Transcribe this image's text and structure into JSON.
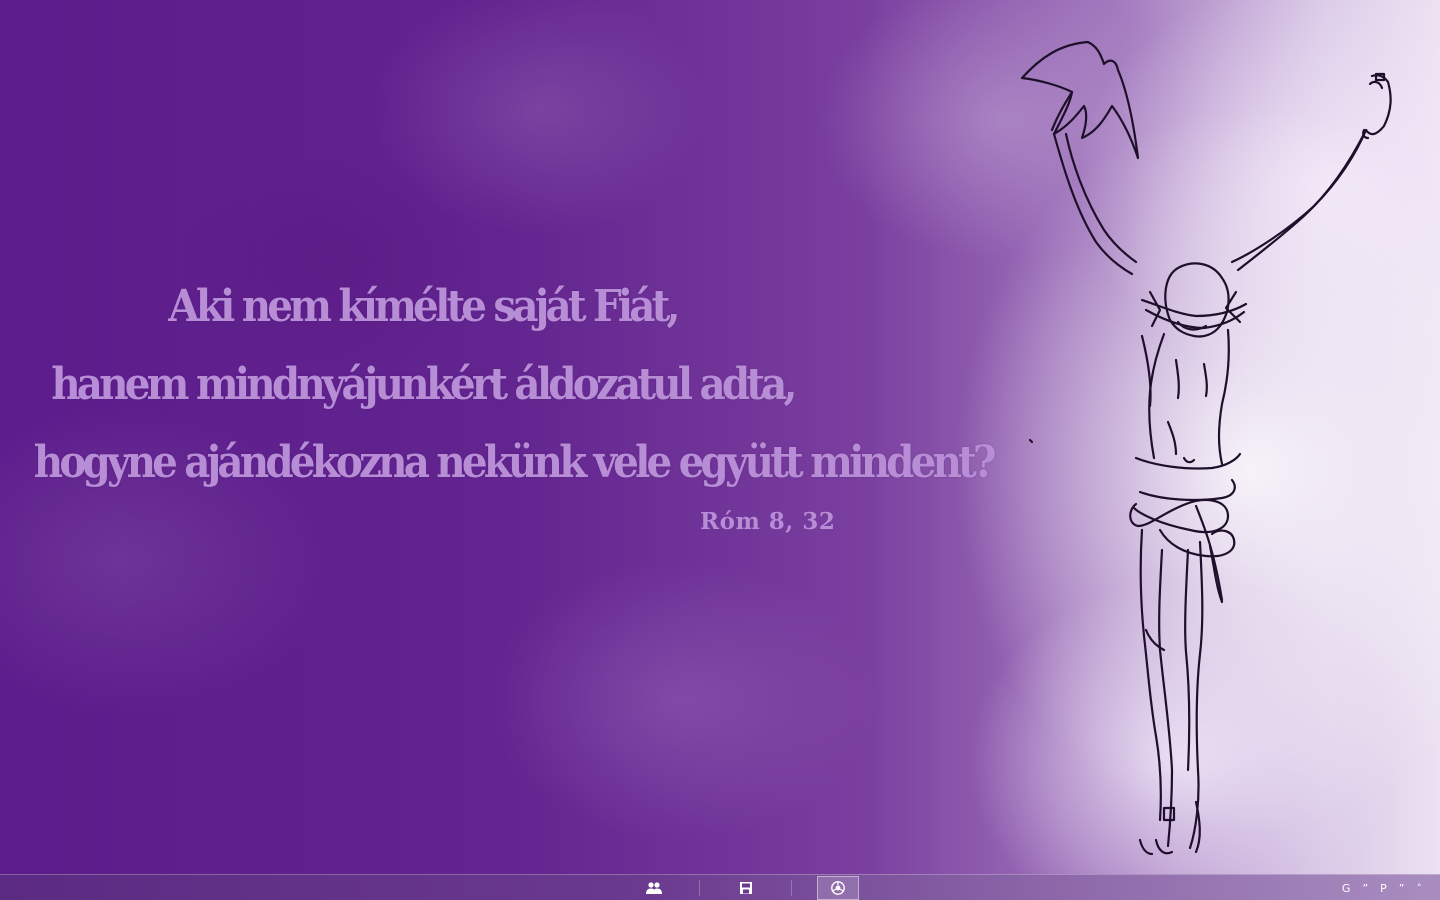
{
  "wallpaper": {
    "verse_lines": [
      "Aki nem kímélte saját Fiát,",
      "hanem mindnyájunkért áldozatul adta,",
      "hogyne ajándékozna nekünk vele együtt mindent?"
    ],
    "reference": "Róm 8, 32",
    "text_color": "#b78ed6",
    "background_colors": [
      "#5c1d8c",
      "#ece2f2"
    ]
  },
  "taskbar": {
    "pinned": [
      {
        "icon": "people-icon",
        "active": false
      },
      {
        "icon": "save-window-icon",
        "active": false
      },
      {
        "icon": "chrome-icon",
        "active": true
      }
    ],
    "tray": {
      "items": [
        "G",
        "”",
        "P",
        "”",
        "˄"
      ]
    }
  }
}
